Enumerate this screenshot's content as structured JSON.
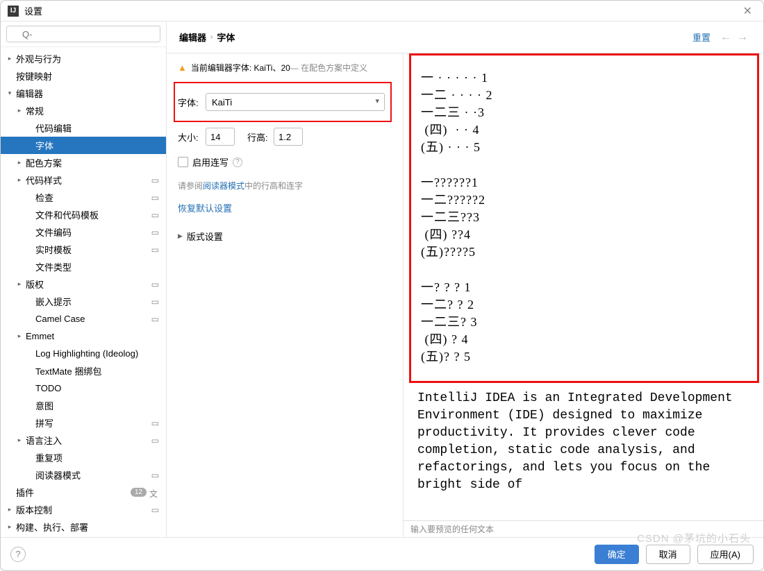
{
  "window": {
    "title": "设置"
  },
  "search": {
    "placeholder": "Q-"
  },
  "sidebar": {
    "items": [
      {
        "label": "外观与行为",
        "indent": 0,
        "chev": "right",
        "cfg": false
      },
      {
        "label": "按键映射",
        "indent": 0,
        "chev": "",
        "cfg": false
      },
      {
        "label": "编辑器",
        "indent": 0,
        "chev": "down",
        "cfg": false
      },
      {
        "label": "常规",
        "indent": 1,
        "chev": "right",
        "cfg": false
      },
      {
        "label": "代码编辑",
        "indent": 2,
        "chev": "",
        "cfg": false
      },
      {
        "label": "字体",
        "indent": 2,
        "chev": "",
        "cfg": false,
        "selected": true
      },
      {
        "label": "配色方案",
        "indent": 1,
        "chev": "right",
        "cfg": false
      },
      {
        "label": "代码样式",
        "indent": 1,
        "chev": "right",
        "cfg": true
      },
      {
        "label": "检查",
        "indent": 2,
        "chev": "",
        "cfg": true
      },
      {
        "label": "文件和代码模板",
        "indent": 2,
        "chev": "",
        "cfg": true
      },
      {
        "label": "文件编码",
        "indent": 2,
        "chev": "",
        "cfg": true
      },
      {
        "label": "实时模板",
        "indent": 2,
        "chev": "",
        "cfg": true
      },
      {
        "label": "文件类型",
        "indent": 2,
        "chev": "",
        "cfg": false
      },
      {
        "label": "版权",
        "indent": 1,
        "chev": "right",
        "cfg": true
      },
      {
        "label": "嵌入提示",
        "indent": 2,
        "chev": "",
        "cfg": true
      },
      {
        "label": "Camel Case",
        "indent": 2,
        "chev": "",
        "cfg": true
      },
      {
        "label": "Emmet",
        "indent": 1,
        "chev": "right",
        "cfg": false
      },
      {
        "label": "Log Highlighting (Ideolog)",
        "indent": 2,
        "chev": "",
        "cfg": false
      },
      {
        "label": "TextMate 捆绑包",
        "indent": 2,
        "chev": "",
        "cfg": false
      },
      {
        "label": "TODO",
        "indent": 2,
        "chev": "",
        "cfg": false
      },
      {
        "label": "意图",
        "indent": 2,
        "chev": "",
        "cfg": false
      },
      {
        "label": "拼写",
        "indent": 2,
        "chev": "",
        "cfg": true
      },
      {
        "label": "语言注入",
        "indent": 1,
        "chev": "right",
        "cfg": true
      },
      {
        "label": "重复项",
        "indent": 2,
        "chev": "",
        "cfg": false
      },
      {
        "label": "阅读器模式",
        "indent": 2,
        "chev": "",
        "cfg": true
      },
      {
        "label": "插件",
        "indent": 0,
        "chev": "",
        "cfg": false,
        "badge": "12",
        "lang": true
      },
      {
        "label": "版本控制",
        "indent": 0,
        "chev": "right",
        "cfg": true
      },
      {
        "label": "构建、执行、部署",
        "indent": 0,
        "chev": "right",
        "cfg": false
      }
    ]
  },
  "crumbs": {
    "a": "编辑器",
    "b": "字体",
    "reset": "重置"
  },
  "form": {
    "warn_a": "当前编辑器字体: KaiTi、20",
    "warn_b": " — 在配色方案中定义",
    "font_label": "字体:",
    "font_value": "KaiTi",
    "size_label": "大小:",
    "size_value": "14",
    "lh_label": "行高:",
    "lh_value": "1.2",
    "ligatures": "启用连写",
    "hint_a": "请参阅",
    "hint_link": "阅读器模式",
    "hint_b": "中的行高和连字",
    "restore": "恢复默认设置",
    "typo": "版式设置"
  },
  "preview": {
    "block1": [
      "一 · · · · · 1",
      "一二 · · · · 2",
      "一二三 · ·3",
      " (四)  · · 4",
      "(五) · · · 5"
    ],
    "block2": [
      "一??????1",
      "一二?????2",
      "一二三??3",
      " (四) ??4",
      "(五)????5"
    ],
    "block3": [
      "一? ? ? 1",
      "一二? ? 2",
      "一二三? 3",
      " (四) ? 4",
      "(五)? ? 5"
    ],
    "desc": "IntelliJ IDEA is an Integrated Development Environment (IDE) designed to maximize productivity. It provides clever code completion, static code analysis, and refactorings, and lets you focus on the bright side of",
    "hint": "输入要预览的任何文本"
  },
  "footer": {
    "ok": "确定",
    "cancel": "取消",
    "apply": "应用(A)"
  },
  "watermark": "CSDN @茅坑的小石头"
}
